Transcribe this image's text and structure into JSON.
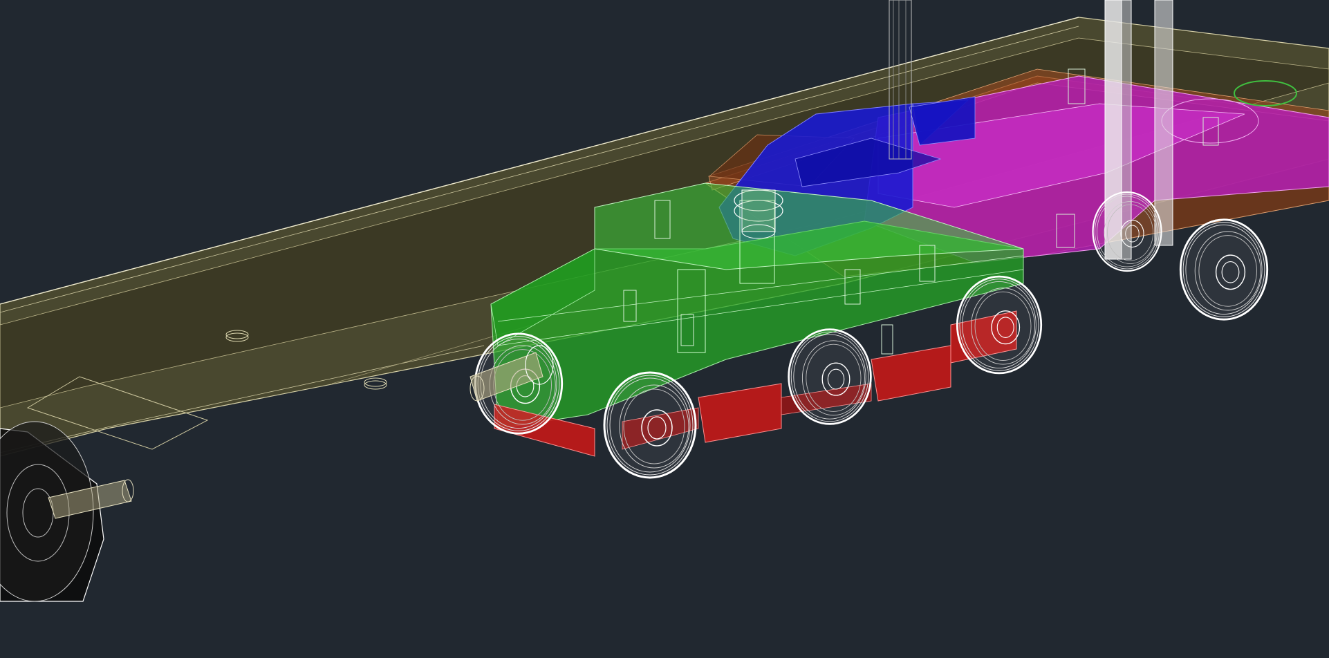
{
  "viewport": {
    "background_color": "#212830",
    "visual_style": "x-ray-wireframe"
  },
  "model": {
    "parts": [
      {
        "id": "chassis-frame",
        "color": "#6b6538",
        "label": ""
      },
      {
        "id": "drive-block",
        "color": "#2ec22e",
        "label": ""
      },
      {
        "id": "wheel-housings",
        "color": "#c41818",
        "label": ""
      },
      {
        "id": "mount-plate",
        "color": "#1414c8",
        "label": ""
      },
      {
        "id": "motor-bracket",
        "color": "#c81ec8",
        "label": ""
      },
      {
        "id": "rear-plate",
        "color": "#8a3a18",
        "label": ""
      },
      {
        "id": "wheels",
        "color": "#ffffff",
        "label": ""
      },
      {
        "id": "motor-can",
        "color": "#0a0a0a",
        "label": ""
      }
    ]
  }
}
